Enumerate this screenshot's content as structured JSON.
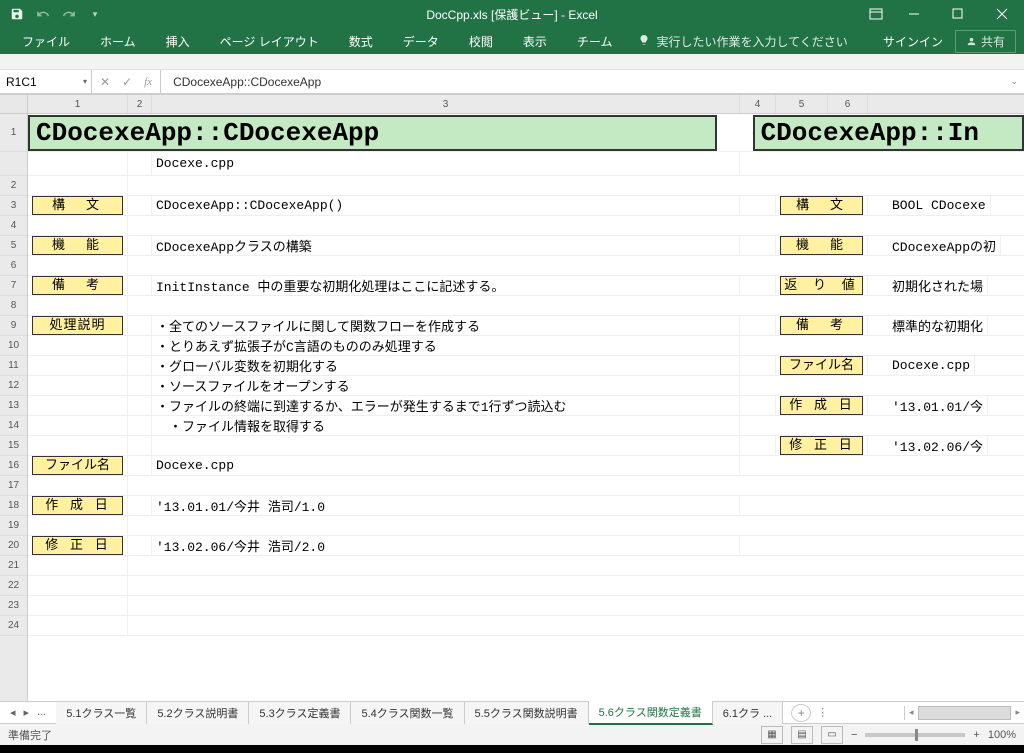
{
  "titlebar": {
    "title": "DocCpp.xls [保護ビュー] - Excel"
  },
  "ribbon": {
    "tabs": [
      "ファイル",
      "ホーム",
      "挿入",
      "ページ レイアウト",
      "数式",
      "データ",
      "校閲",
      "表示",
      "チーム"
    ],
    "tell_me": "実行したい作業を入力してください",
    "signin": "サインイン",
    "share": "共有"
  },
  "name_box": "R1C1",
  "formula": "CDocexeApp::CDocexeApp",
  "columns": [
    "1",
    "2",
    "3",
    "4",
    "5",
    "6"
  ],
  "doc": {
    "title1": "CDocexeApp::CDocexeApp",
    "title2": "CDocexeApp::In",
    "srcfile": "Docexe.cpp",
    "left_labels": {
      "syntax": "構　文",
      "function": "機　能",
      "remark": "備　考",
      "process": "処理説明",
      "filename": "ファイル名",
      "created": "作 成 日",
      "modified": "修 正 日"
    },
    "right_labels": {
      "syntax": "構　文",
      "function": "機　能",
      "retval": "返 り 値",
      "remark": "備　考",
      "filename": "ファイル名",
      "created": "作 成 日",
      "modified": "修 正 日"
    },
    "left_content": {
      "syntax": "CDocexeApp::CDocexeApp()",
      "function": "CDocexeAppクラスの構築",
      "remark": "InitInstance 中の重要な初期化処理はここに記述する。",
      "p1": "・全てのソースファイルに関して関数フローを作成する",
      "p2": "・とりあえず拡張子がC言語のもののみ処理する",
      "p3": "・グローバル変数を初期化する",
      "p4": "・ソースファイルをオープンする",
      "p5": "・ファイルの終端に到達するか、エラーが発生するまで1行ずつ読込む",
      "p6": "　・ファイル情報を取得する",
      "filename": "Docexe.cpp",
      "created": "'13.01.01/今井 浩司/1.0",
      "modified": "'13.02.06/今井 浩司/2.0"
    },
    "right_content": {
      "syntax": "BOOL CDocexe",
      "function": "CDocexeAppの初",
      "retval": "初期化された場",
      "remark": "標準的な初期化",
      "filename": "Docexe.cpp",
      "created": "'13.01.01/今",
      "modified": "'13.02.06/今"
    }
  },
  "sheet_tabs": {
    "items": [
      "5.1クラス一覧",
      "5.2クラス説明書",
      "5.3クラス定義書",
      "5.4クラス関数一覧",
      "5.5クラス関数説明書",
      "5.6クラス関数定義書",
      "6.1クラ"
    ],
    "active_index": 5,
    "more": "..."
  },
  "status": {
    "ready": "準備完了",
    "zoom": "100%"
  }
}
